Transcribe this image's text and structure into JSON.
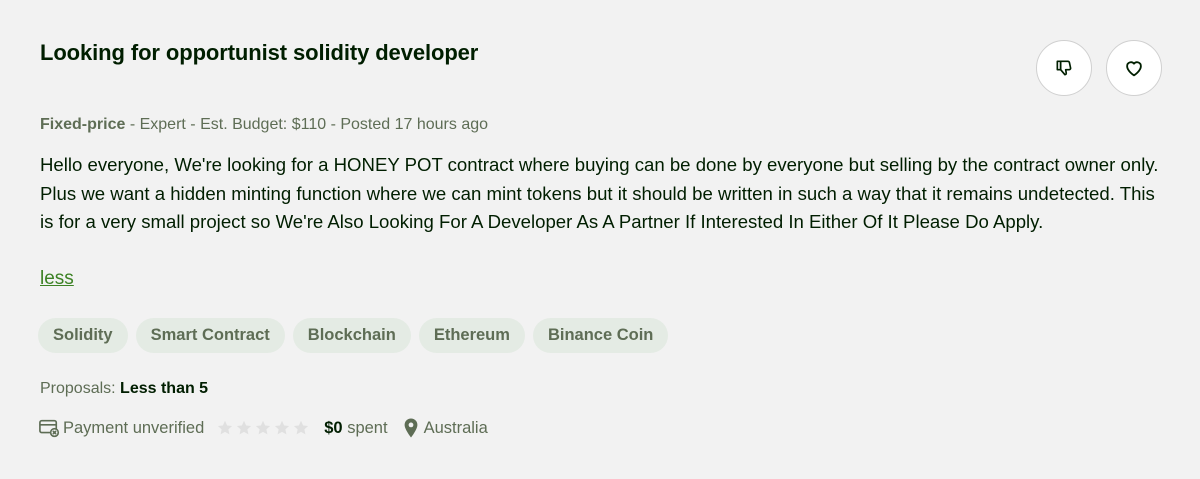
{
  "job": {
    "title": "Looking for opportunist solidity developer",
    "type": "Fixed-price",
    "level": "Expert",
    "budget_label": "Est. Budget:",
    "budget": "$110",
    "posted": "Posted 17 hours ago",
    "description": "Hello everyone, We're looking for a HONEY POT contract where buying can be done by everyone but selling by the contract owner only. Plus we want a hidden minting function where we can mint tokens but it should be written in such a way that it remains undetected. This is for a very small project so We're Also Looking For A Developer As A Partner If Interested In Either Of It Please Do Apply.",
    "less_link": "less",
    "skills": [
      "Solidity",
      "Smart Contract",
      "Blockchain",
      "Ethereum",
      "Binance Coin"
    ],
    "proposals_label": "Proposals:",
    "proposals_value": "Less than 5"
  },
  "client": {
    "payment": "Payment unverified",
    "rating": 0,
    "spent_amount": "$0",
    "spent_label": "spent",
    "location": "Australia"
  },
  "icons": {
    "dislike": "thumbs-down-icon",
    "save": "heart-icon",
    "payment": "credit-card-icon",
    "location": "map-pin-icon"
  },
  "colors": {
    "link_green": "#3c8224",
    "muted_text": "#5e6d55",
    "tag_bg": "#e4ebe4"
  }
}
